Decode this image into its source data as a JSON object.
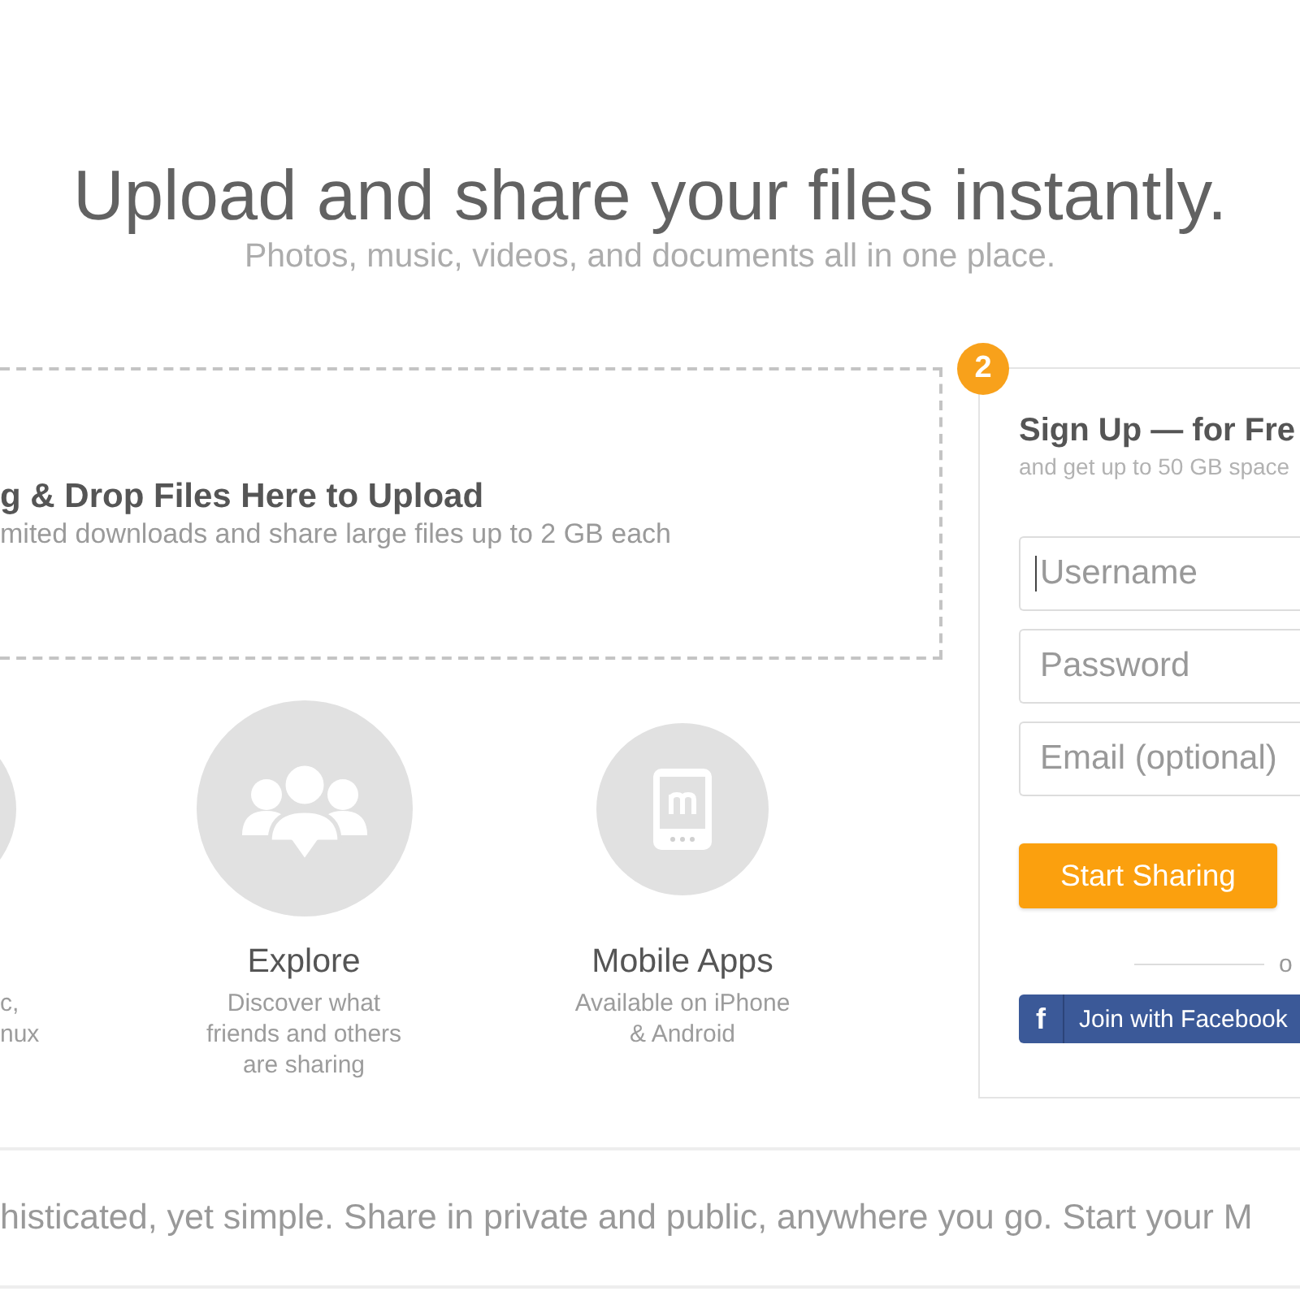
{
  "hero": {
    "title": "Upload and share your files instantly.",
    "subtitle": "Photos, music, videos, and documents all in one place."
  },
  "drop_zone": {
    "title": "g & Drop Files Here to Upload",
    "description": "mited downloads and share large files up to 2 GB each"
  },
  "features": [
    {
      "kind": "cut",
      "description": "c, nux"
    },
    {
      "kind": "people",
      "title": "Explore",
      "description": "Discover what friends and others are sharing"
    },
    {
      "kind": "phone",
      "title": "Mobile Apps",
      "description": "Available on iPhone & Android"
    }
  ],
  "signup": {
    "step": "2",
    "title": "Sign Up — for Fre",
    "subtitle": "and get up to 50 GB space",
    "fields": [
      {
        "placeholder": "Username",
        "focused": true
      },
      {
        "placeholder": "Password",
        "focused": false
      },
      {
        "placeholder": "Email (optional)",
        "focused": false
      }
    ],
    "submit": "Start Sharing",
    "separator": "o",
    "facebook": {
      "icon": "f",
      "label": "Join with Facebook"
    }
  },
  "tagline": "histicated, yet simple. Share in private and public, anywhere you go. Start your M"
}
